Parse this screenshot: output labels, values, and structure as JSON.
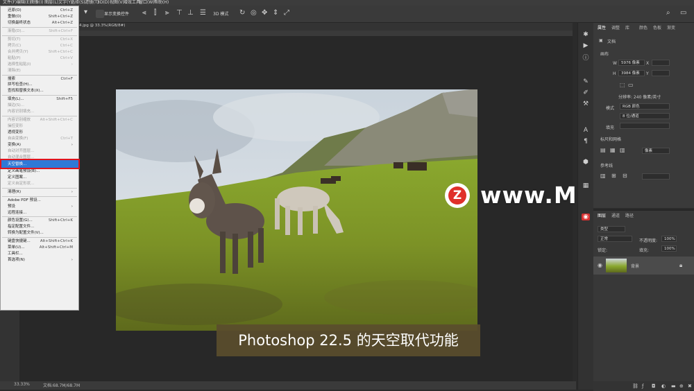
{
  "menubar": {
    "items": [
      "文件(F)",
      "编辑(E)",
      "图像(I)",
      "图层(L)",
      "文字(Y)",
      "选择(S)",
      "滤镜(T)",
      "3D(D)",
      "视图(V)",
      "增效工具",
      "窗口(W)",
      "帮助(H)"
    ]
  },
  "options": {
    "auto_select_label": "显示变换控件",
    "mode_label": "3D 模式"
  },
  "document": {
    "tab": "4.jpg @ 33.3%(RGB/8#)",
    "zoom": "33.33%",
    "docinfo": "文档:68.7M/68.7M"
  },
  "edit_menu": {
    "items": [
      {
        "label": "还原(O)",
        "shortcut": "Ctrl+Z",
        "disabled": false
      },
      {
        "label": "重做(O)",
        "shortcut": "Shift+Ctrl+Z",
        "disabled": false
      },
      {
        "label": "切换最终状态",
        "shortcut": "Alt+Ctrl+Z",
        "disabled": false
      },
      {
        "sep": true
      },
      {
        "label": "渐隐(D)...",
        "shortcut": "Shift+Ctrl+F",
        "disabled": true
      },
      {
        "sep": true
      },
      {
        "label": "剪切(T)",
        "shortcut": "Ctrl+X",
        "disabled": true
      },
      {
        "label": "拷贝(C)",
        "shortcut": "Ctrl+C",
        "disabled": true
      },
      {
        "label": "合并拷贝(Y)",
        "shortcut": "Shift+Ctrl+C",
        "disabled": true
      },
      {
        "label": "粘贴(P)",
        "shortcut": "Ctrl+V",
        "disabled": true
      },
      {
        "label": "选择性粘贴(I)",
        "shortcut": "›",
        "disabled": true
      },
      {
        "label": "清除(E)",
        "shortcut": "",
        "disabled": true
      },
      {
        "sep": true
      },
      {
        "label": "搜索",
        "shortcut": "Ctrl+F",
        "disabled": false
      },
      {
        "label": "拼写检查(H)...",
        "shortcut": "",
        "disabled": false
      },
      {
        "label": "查找和替换文本(X)...",
        "shortcut": "",
        "disabled": false
      },
      {
        "sep": true
      },
      {
        "label": "填充(L)...",
        "shortcut": "Shift+F5",
        "disabled": false
      },
      {
        "label": "描边(S)...",
        "shortcut": "",
        "disabled": true
      },
      {
        "label": "内容识别填充...",
        "shortcut": "",
        "disabled": true
      },
      {
        "sep": true
      },
      {
        "label": "内容识别缩放",
        "shortcut": "Alt+Shift+Ctrl+C",
        "disabled": true
      },
      {
        "label": "操控变形",
        "shortcut": "",
        "disabled": true
      },
      {
        "label": "透视变形",
        "shortcut": "",
        "disabled": false
      },
      {
        "label": "自由变换(F)",
        "shortcut": "Ctrl+T",
        "disabled": true
      },
      {
        "label": "变换(A)",
        "shortcut": "›",
        "disabled": false
      },
      {
        "label": "自动对齐图层...",
        "shortcut": "",
        "disabled": true
      },
      {
        "label": "自动混合图层...",
        "shortcut": "",
        "disabled": true
      },
      {
        "label": "天空替换...",
        "shortcut": "",
        "disabled": false,
        "highlight": true
      },
      {
        "label": "定义画笔预设(B)...",
        "shortcut": "",
        "disabled": false
      },
      {
        "label": "定义图案...",
        "shortcut": "",
        "disabled": false
      },
      {
        "label": "定义自定形状...",
        "shortcut": "",
        "disabled": true
      },
      {
        "sep": true
      },
      {
        "label": "清理(R)",
        "shortcut": "›",
        "disabled": false
      },
      {
        "sep": true
      },
      {
        "label": "Adobe PDF 预设...",
        "shortcut": "",
        "disabled": false
      },
      {
        "label": "预设",
        "shortcut": "›",
        "disabled": false
      },
      {
        "label": "远程连接...",
        "shortcut": "",
        "disabled": false
      },
      {
        "sep": true
      },
      {
        "label": "颜色设置(G)...",
        "shortcut": "Shift+Ctrl+K",
        "disabled": false
      },
      {
        "label": "指定配置文件...",
        "shortcut": "",
        "disabled": false
      },
      {
        "label": "转换为配置文件(V)...",
        "shortcut": "",
        "disabled": false
      },
      {
        "sep": true
      },
      {
        "label": "键盘快捷键...",
        "shortcut": "Alt+Shift+Ctrl+K",
        "disabled": false
      },
      {
        "label": "菜单(U)...",
        "shortcut": "Alt+Shift+Ctrl+M",
        "disabled": false
      },
      {
        "label": "工具栏...",
        "shortcut": "",
        "disabled": false
      },
      {
        "label": "首选项(N)",
        "shortcut": "›",
        "disabled": false
      }
    ]
  },
  "properties": {
    "tabs": [
      "属性",
      "调整",
      "库",
      "颜色",
      "色板",
      "渐变"
    ],
    "doc_label": "文档",
    "canvas_heading": "画布",
    "w_label": "W",
    "w_value": "5976 像素",
    "h_label": "H",
    "h_value": "3984 像素",
    "x_label": "X",
    "y_label": "Y",
    "resolution": "分辨率: 240 像素/英寸",
    "mode_label": "模式",
    "mode_value": "RGB 颜色",
    "bits_value": "8 位/通道",
    "fill_label": "填充",
    "rulers_heading": "标尺和网格",
    "rulers_unit": "像素",
    "guides_heading": "参考线"
  },
  "layers": {
    "tabs": [
      "图层",
      "通道",
      "路径"
    ],
    "kind_label": "类型",
    "blend_value": "正常",
    "opacity_label": "不透明度:",
    "opacity_value": "100%",
    "lock_label": "锁定:",
    "fill_label": "填充:",
    "fill_value": "100%",
    "layer_name": "背景"
  },
  "subtitle": "Photoshop 22.5 的天空取代功能",
  "watermark": {
    "logo": "Z",
    "text": "www.MacZ.com"
  },
  "colors": {
    "highlight": "#2f79d6",
    "highlight_box": "#e0141e",
    "subtitle_bg": "#5a4d2d",
    "watermark_red": "#e0302a"
  }
}
